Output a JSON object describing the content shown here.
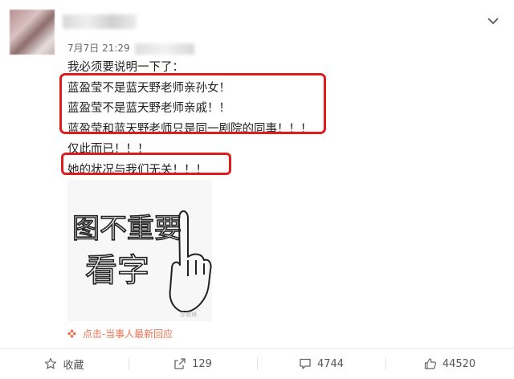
{
  "post": {
    "time": "7月7日 21:29",
    "lines": [
      "我必须要说明一下了：",
      "蓝盈莹不是蓝天野老师亲孙女！",
      "蓝盈莹不是蓝天野老师亲戚！！",
      "蓝盈莹和蓝天野老师只是同一剧院的同事！！！",
      "仅此而已！！！",
      "她的状况与我们无关！！！"
    ],
    "image_text": [
      "图不重要",
      "看字"
    ],
    "watermark": "@微博",
    "recent_link": "点击-当事人最新回应"
  },
  "actions": {
    "collect_label": "收藏",
    "repost_count": "129",
    "comment_count": "4744",
    "like_count": "44520"
  },
  "colors": {
    "highlight_box": "#e01b1b",
    "link_orange": "#eb7350"
  },
  "icons": [
    "chevron-down-icon",
    "star-icon",
    "repost-icon",
    "comment-icon",
    "like-icon",
    "flower-icon"
  ]
}
